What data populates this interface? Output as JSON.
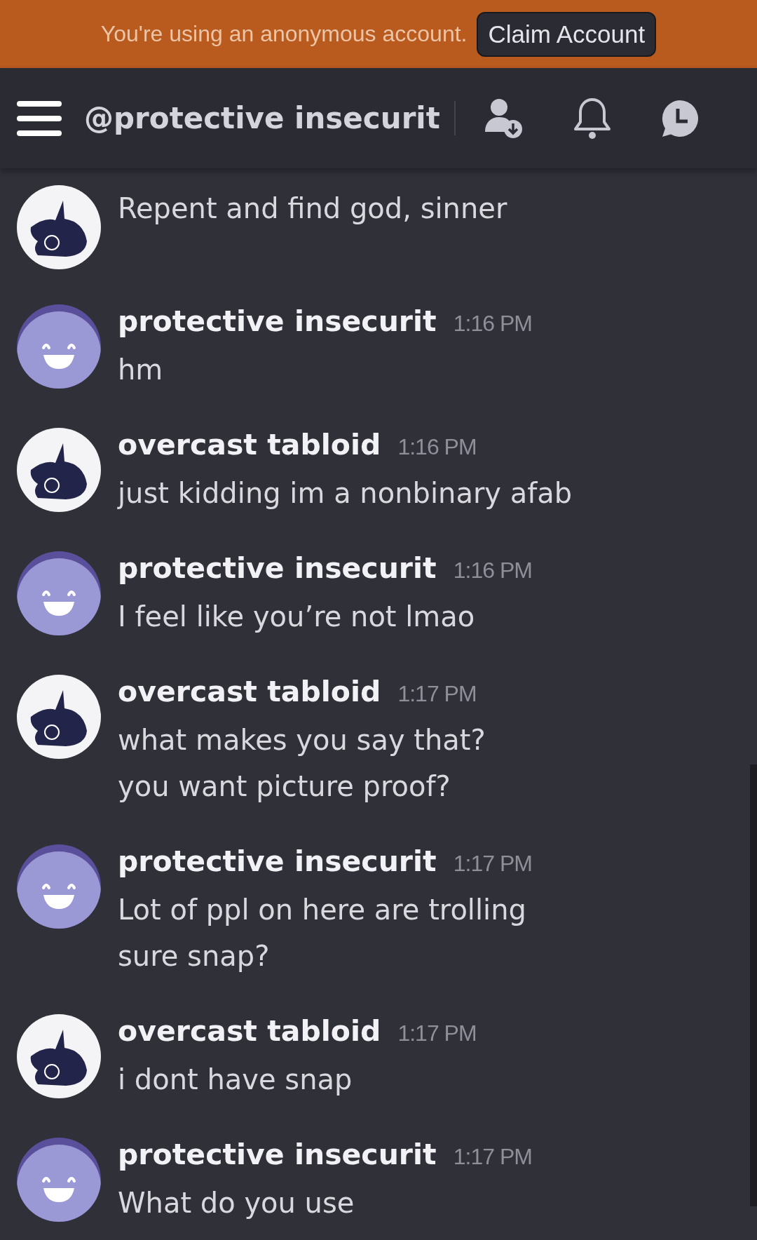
{
  "banner": {
    "text": "You're using an anonymous account.",
    "button": "Claim Account"
  },
  "header": {
    "title": "@protective insecurit"
  },
  "messages": [
    {
      "kind": "drawn",
      "lines": [
        "Repent and find god, sinner"
      ]
    },
    {
      "kind": "smiley",
      "author": "protective insecurit",
      "time": "1:16 PM",
      "lines": [
        "hm"
      ]
    },
    {
      "kind": "drawn",
      "author": "overcast tabloid",
      "time": "1:16 PM",
      "lines": [
        "just kidding im a nonbinary afab"
      ]
    },
    {
      "kind": "smiley",
      "author": "protective insecurit",
      "time": "1:16 PM",
      "lines": [
        "I feel like you’re not lmao"
      ]
    },
    {
      "kind": "drawn",
      "author": "overcast tabloid",
      "time": "1:17 PM",
      "lines": [
        "what makes you say that?",
        "you want picture proof?"
      ]
    },
    {
      "kind": "smiley",
      "author": "protective insecurit",
      "time": "1:17 PM",
      "lines": [
        "Lot of ppl on here are trolling",
        "sure snap?"
      ]
    },
    {
      "kind": "drawn",
      "author": "overcast tabloid",
      "time": "1:17 PM",
      "lines": [
        "i dont have snap"
      ]
    },
    {
      "kind": "smiley",
      "author": "protective insecurit",
      "time": "1:17 PM",
      "lines": [
        "What do you use"
      ]
    }
  ]
}
